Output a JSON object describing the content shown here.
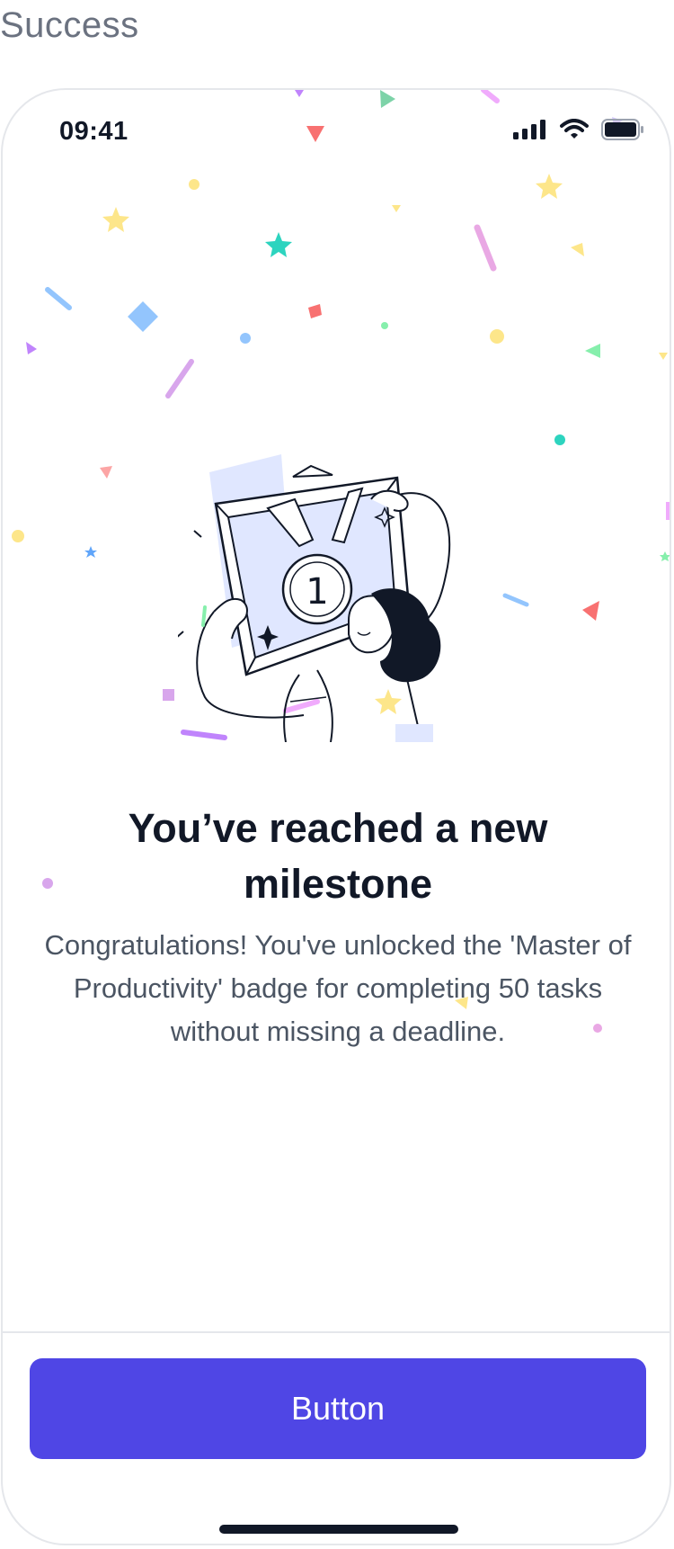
{
  "page_label": "Success",
  "status_bar": {
    "time": "09:41",
    "signal_icon": "signal-bars-icon",
    "wifi_icon": "wifi-icon",
    "battery_icon": "battery-icon"
  },
  "illustration": {
    "icon": "milestone-badge-illustration",
    "badge_number": "1"
  },
  "content": {
    "title": "You’ve reached a new milestone",
    "message": "Congratulations! You've unlocked the 'Master of Productivity' badge for completing 50 tasks without missing a deadline."
  },
  "footer": {
    "button_label": "Button"
  },
  "colors": {
    "primary": "#4f46e5",
    "title_text": "#111827",
    "body_text": "#4b5563",
    "border": "#e5e7eb"
  }
}
